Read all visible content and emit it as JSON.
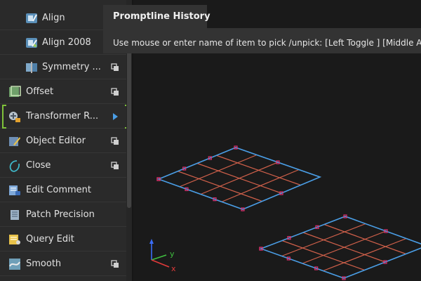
{
  "sidebar": {
    "items": [
      {
        "label": "Align",
        "icon": "align-icon",
        "indent": "sub",
        "trailing": ""
      },
      {
        "label": "Align 2008",
        "icon": "align-2008-icon",
        "indent": "sub",
        "trailing": ""
      },
      {
        "label": "Symmetry ...",
        "icon": "symmetry-icon",
        "indent": "sub",
        "trailing": "copy-icon"
      },
      {
        "label": "Offset",
        "icon": "offset-icon",
        "indent": "top",
        "trailing": "copy-icon"
      },
      {
        "label": "Transformer R...",
        "icon": "transformer-icon",
        "indent": "top",
        "trailing": "expand-arrow-icon"
      },
      {
        "label": "Object Editor",
        "icon": "object-editor-icon",
        "indent": "top",
        "trailing": "copy-icon"
      },
      {
        "label": "Close",
        "icon": "close-curve-icon",
        "indent": "top",
        "trailing": "copy-icon"
      },
      {
        "label": "Edit Comment",
        "icon": "edit-comment-icon",
        "indent": "top",
        "trailing": ""
      },
      {
        "label": "Patch Precision",
        "icon": "patch-precision-icon",
        "indent": "top",
        "trailing": ""
      },
      {
        "label": "Query Edit",
        "icon": "query-edit-icon",
        "indent": "top",
        "trailing": ""
      },
      {
        "label": "Smooth",
        "icon": "smooth-icon",
        "indent": "top",
        "trailing": "copy-icon"
      }
    ],
    "highlighted_item": "Transformer R..."
  },
  "prompt_history": {
    "title": "Promptline History",
    "message": "Use mouse or enter name of item to pick /unpick: [Left Toggle ] [Middle Ad"
  },
  "axis_triad": {
    "y_label": "y",
    "x_label": "x",
    "z_color": "#3a6cf5",
    "y_color": "#3fbf3f",
    "x_color": "#e03a3a"
  },
  "colors": {
    "patch_border": "#4a9ee6",
    "isoparm": "#d0604a",
    "cv_point": "#e0306e",
    "selection_bracket": "#7fc23a",
    "expand_arrow": "#4a9ee6"
  }
}
